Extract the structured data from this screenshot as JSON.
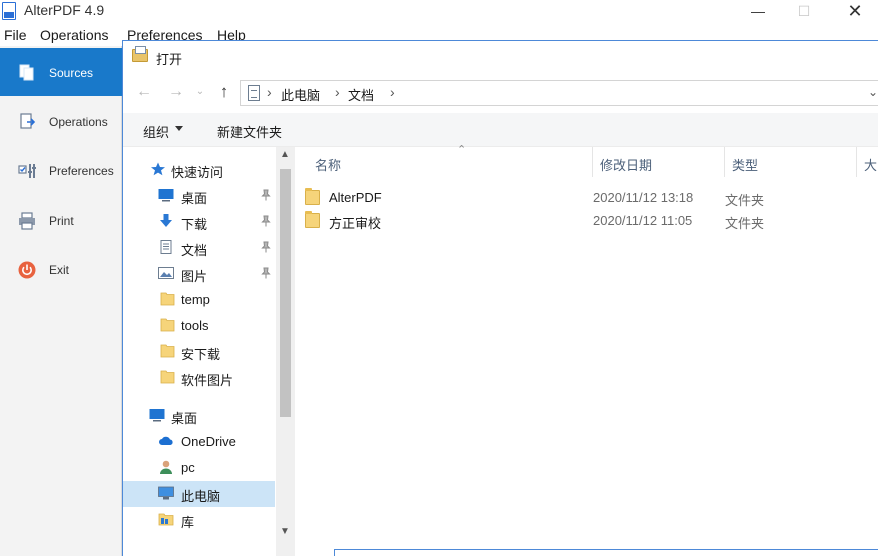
{
  "app": {
    "title": "AlterPDF 4.9",
    "minimize": "—",
    "maximize": "☐",
    "close": "✕",
    "menu": [
      "File",
      "Operations",
      "Preferences",
      "Help"
    ],
    "sidebar": [
      {
        "label": "Sources",
        "icon": "sources-icon",
        "active": true
      },
      {
        "label": "Operations",
        "icon": "operations-icon",
        "active": false
      },
      {
        "label": "Preferences",
        "icon": "preferences-icon",
        "active": false
      },
      {
        "label": "Print",
        "icon": "printer-icon",
        "active": false
      },
      {
        "label": "Exit",
        "icon": "power-icon",
        "active": false
      }
    ]
  },
  "dialog": {
    "title": "打开",
    "nav": {
      "back": "←",
      "forward": "→",
      "recent": "⌄",
      "up": "↑"
    },
    "address": {
      "segments": [
        "此电脑",
        "文档"
      ],
      "separator": "›",
      "dropdown": "⌄"
    },
    "toolbar": {
      "organize": "组织",
      "new_folder": "新建文件夹"
    },
    "tree": [
      {
        "label": "快速访问",
        "icon": "star-icon",
        "pinned": false,
        "indent": 1
      },
      {
        "label": "桌面",
        "icon": "desktop-icon",
        "pinned": true,
        "indent": 2
      },
      {
        "label": "下载",
        "icon": "download-icon",
        "pinned": true,
        "indent": 2
      },
      {
        "label": "文档",
        "icon": "document-icon",
        "pinned": true,
        "indent": 2
      },
      {
        "label": "图片",
        "icon": "pictures-icon",
        "pinned": true,
        "indent": 2
      },
      {
        "label": "temp",
        "icon": "folder-icon",
        "pinned": false,
        "indent": 2
      },
      {
        "label": "tools",
        "icon": "folder-icon",
        "pinned": false,
        "indent": 2
      },
      {
        "label": "安下载",
        "icon": "folder-icon",
        "pinned": false,
        "indent": 2
      },
      {
        "label": "软件图片",
        "icon": "folder-icon",
        "pinned": false,
        "indent": 2
      },
      {
        "label": "桌面",
        "icon": "desktop-icon",
        "pinned": false,
        "indent": 1
      },
      {
        "label": "OneDrive",
        "icon": "cloud-icon",
        "pinned": false,
        "indent": 2
      },
      {
        "label": "pc",
        "icon": "user-icon",
        "pinned": false,
        "indent": 2
      },
      {
        "label": "此电脑",
        "icon": "computer-icon",
        "pinned": false,
        "indent": 2,
        "selected": true
      },
      {
        "label": "库",
        "icon": "library-icon",
        "pinned": false,
        "indent": 2
      }
    ],
    "columns": {
      "name": "名称",
      "modified": "修改日期",
      "type": "类型",
      "size": "大"
    },
    "files": [
      {
        "name": "AlterPDF",
        "modified": "2020/11/12 13:18",
        "type": "文件夹"
      },
      {
        "name": "方正审校",
        "modified": "2020/11/12 11:05",
        "type": "文件夹"
      }
    ],
    "scroll": {
      "up": "▲",
      "down": "▼"
    }
  },
  "colors": {
    "accent": "#1979ca",
    "selection": "#cce4f7",
    "border": "#4d89d8",
    "folder": "#f6d47a"
  }
}
